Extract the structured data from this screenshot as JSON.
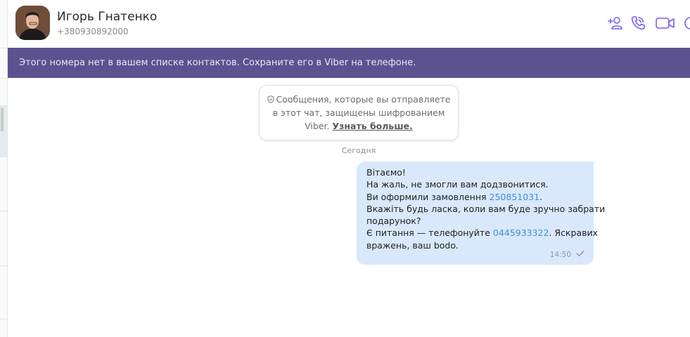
{
  "chat": {
    "contact_name": "Игорь Гнатенко",
    "contact_phone": "+380930892000",
    "header_icons": [
      "add-contact-icon",
      "voice-call-icon",
      "video-call-icon",
      "more-icon"
    ]
  },
  "banner": {
    "text": "Этого номера нет в вашем списке контактов. Сохраните его в Viber на телефоне."
  },
  "notice": {
    "line1": "Сообщения, которые вы отправляете",
    "line2": "в этот чат, защищены шифрованием",
    "line3_prefix": "Viber.",
    "link_label": "Узнать больше."
  },
  "date_separator": "Сегодня",
  "message": {
    "line1": "Вітаємо!",
    "line2": "На жаль, не змогли вам додзвонитися.",
    "line3_prefix": "Ви оформили замовлення",
    "order_number": "250851031",
    "line3_suffix": ".",
    "line4": "Вкажіть будь ласка, коли вам буде зручно забрати",
    "line5": "подарунок?",
    "line6_prefix": "Є питання — телефонуйте",
    "phone_link": "0445933322",
    "line6_suffix": ". Яскравих",
    "line7": "вражень, ваш bodo.",
    "time": "14:50",
    "status": "sent"
  },
  "colors": {
    "banner_bg": "#5c5290",
    "accent": "#7360f2",
    "bubble_bg": "#d9e8fb",
    "link": "#3a8fd6"
  }
}
